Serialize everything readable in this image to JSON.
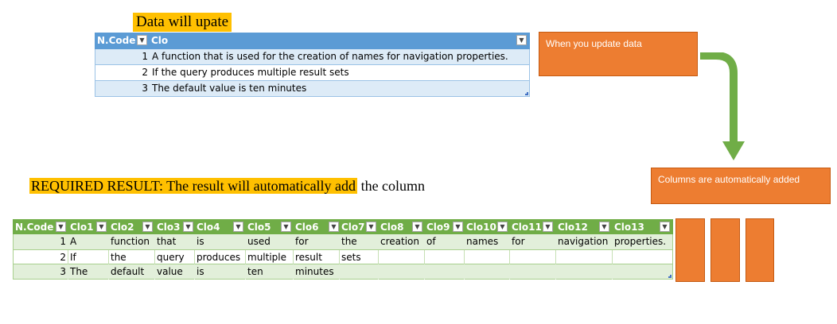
{
  "title_top": "Data will upate",
  "title_bottom_highlight": "REQUIRED RESULT: The result will automatically add",
  "title_bottom_rest": " the column",
  "table1": {
    "headers": [
      "N.Code",
      "Clo"
    ],
    "rows": [
      [
        "1",
        "A function that is used for the creation of names for navigation properties."
      ],
      [
        "2",
        "If the query produces multiple result sets"
      ],
      [
        "3",
        "The default value is ten minutes"
      ]
    ]
  },
  "table2": {
    "headers": [
      "N.Code",
      "Clo1",
      "Clo2",
      "Clo3",
      "Clo4",
      "Clo5",
      "Clo6",
      "Clo7",
      "Clo8",
      "Clo9",
      "Clo10",
      "Clo11",
      "Clo12",
      "Clo13"
    ],
    "rows": [
      [
        "1",
        "A",
        "function",
        "that",
        "is",
        "used",
        "for",
        "the",
        "creation",
        "of",
        "names",
        "for",
        "navigation",
        "properties."
      ],
      [
        "2",
        "If",
        "the",
        "query",
        "produces",
        "multiple",
        "result",
        "sets",
        "",
        "",
        "",
        "",
        "",
        ""
      ],
      [
        "3",
        "The",
        "default",
        "value",
        "is",
        "ten",
        "minutes",
        "",
        "",
        "",
        "",
        "",
        "",
        ""
      ]
    ]
  },
  "callout_update": "When you update data",
  "callout_added": "Columns are automatically added",
  "colors": {
    "blue_header": "#5b9bd5",
    "blue_band": "#ddebf7",
    "green_header": "#70ad47",
    "green_band": "#e2efda",
    "orange": "#ed7d31",
    "arrow_green": "#70ad47",
    "highlight": "#ffc000"
  },
  "icons": {
    "filter_dropdown": "chevron-down-icon"
  }
}
